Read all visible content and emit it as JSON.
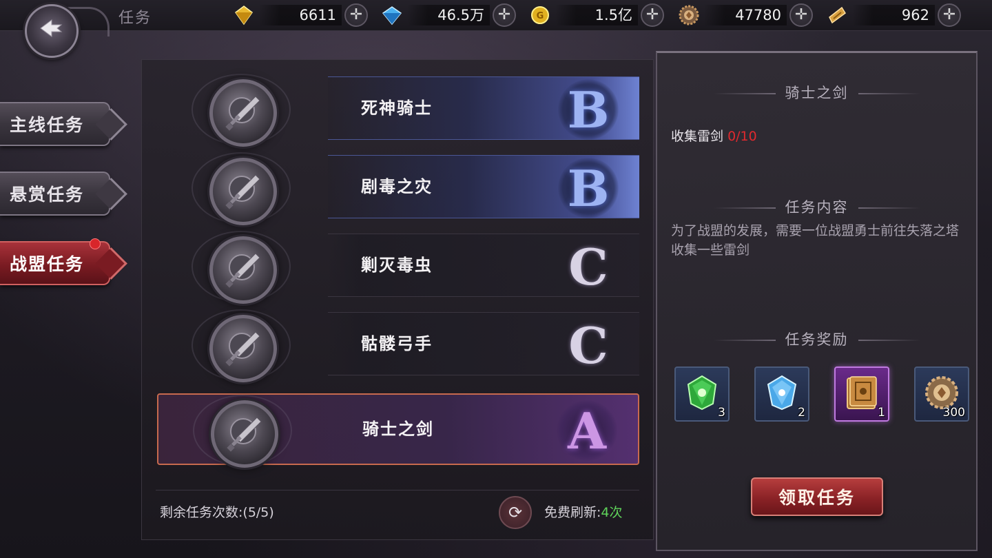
{
  "header": {
    "title": "任务",
    "currencies": [
      {
        "icon": "gold-diamond-icon",
        "value": "6611",
        "color": "#e8b830"
      },
      {
        "icon": "blue-diamond-icon",
        "value": "46.5万",
        "color": "#4ab0f0"
      },
      {
        "icon": "gold-coin-icon",
        "value": "1.5亿",
        "color": "#e0b020"
      },
      {
        "icon": "honor-medal-icon",
        "value": "47780",
        "color": "#c89860"
      },
      {
        "icon": "voucher-icon",
        "value": "962",
        "color": "#d8a040"
      }
    ]
  },
  "sidebar": {
    "tabs": [
      {
        "label": "主线任务",
        "active": false
      },
      {
        "label": "悬赏任务",
        "active": false
      },
      {
        "label": "战盟任务",
        "active": true,
        "badge": true
      }
    ]
  },
  "quests": [
    {
      "name": "死神骑士",
      "grade": "B"
    },
    {
      "name": "剧毒之灾",
      "grade": "B"
    },
    {
      "name": "剿灭毒虫",
      "grade": "C"
    },
    {
      "name": "骷髅弓手",
      "grade": "C"
    },
    {
      "name": "骑士之剑",
      "grade": "A",
      "selected": true
    }
  ],
  "footer": {
    "remaining_label": "剩余任务次数:(5/5)",
    "free_refresh_label": "免费刷新:",
    "free_refresh_count": "4次"
  },
  "detail": {
    "quest_title": "骑士之剑",
    "objective_label": "收集雷剑",
    "objective_progress": "0/10",
    "content_title": "任务内容",
    "content_text": "为了战盟的发展，需要一位战盟勇士前往失落之塔收集一些雷剑",
    "reward_title": "任务奖励",
    "rewards": [
      {
        "icon": "green-gem-icon",
        "qty": "3"
      },
      {
        "icon": "blue-crystal-icon",
        "qty": "2"
      },
      {
        "icon": "skill-book-icon",
        "qty": "1"
      },
      {
        "icon": "honor-medal-icon",
        "qty": "300"
      }
    ],
    "accept_button": "领取任务"
  },
  "colors": {
    "accent_red": "#8a2226",
    "progress_red": "#e0292e",
    "refresh_green": "#5fd45a",
    "grade_b": "#9db3f2",
    "grade_a": "#cc96e4"
  }
}
